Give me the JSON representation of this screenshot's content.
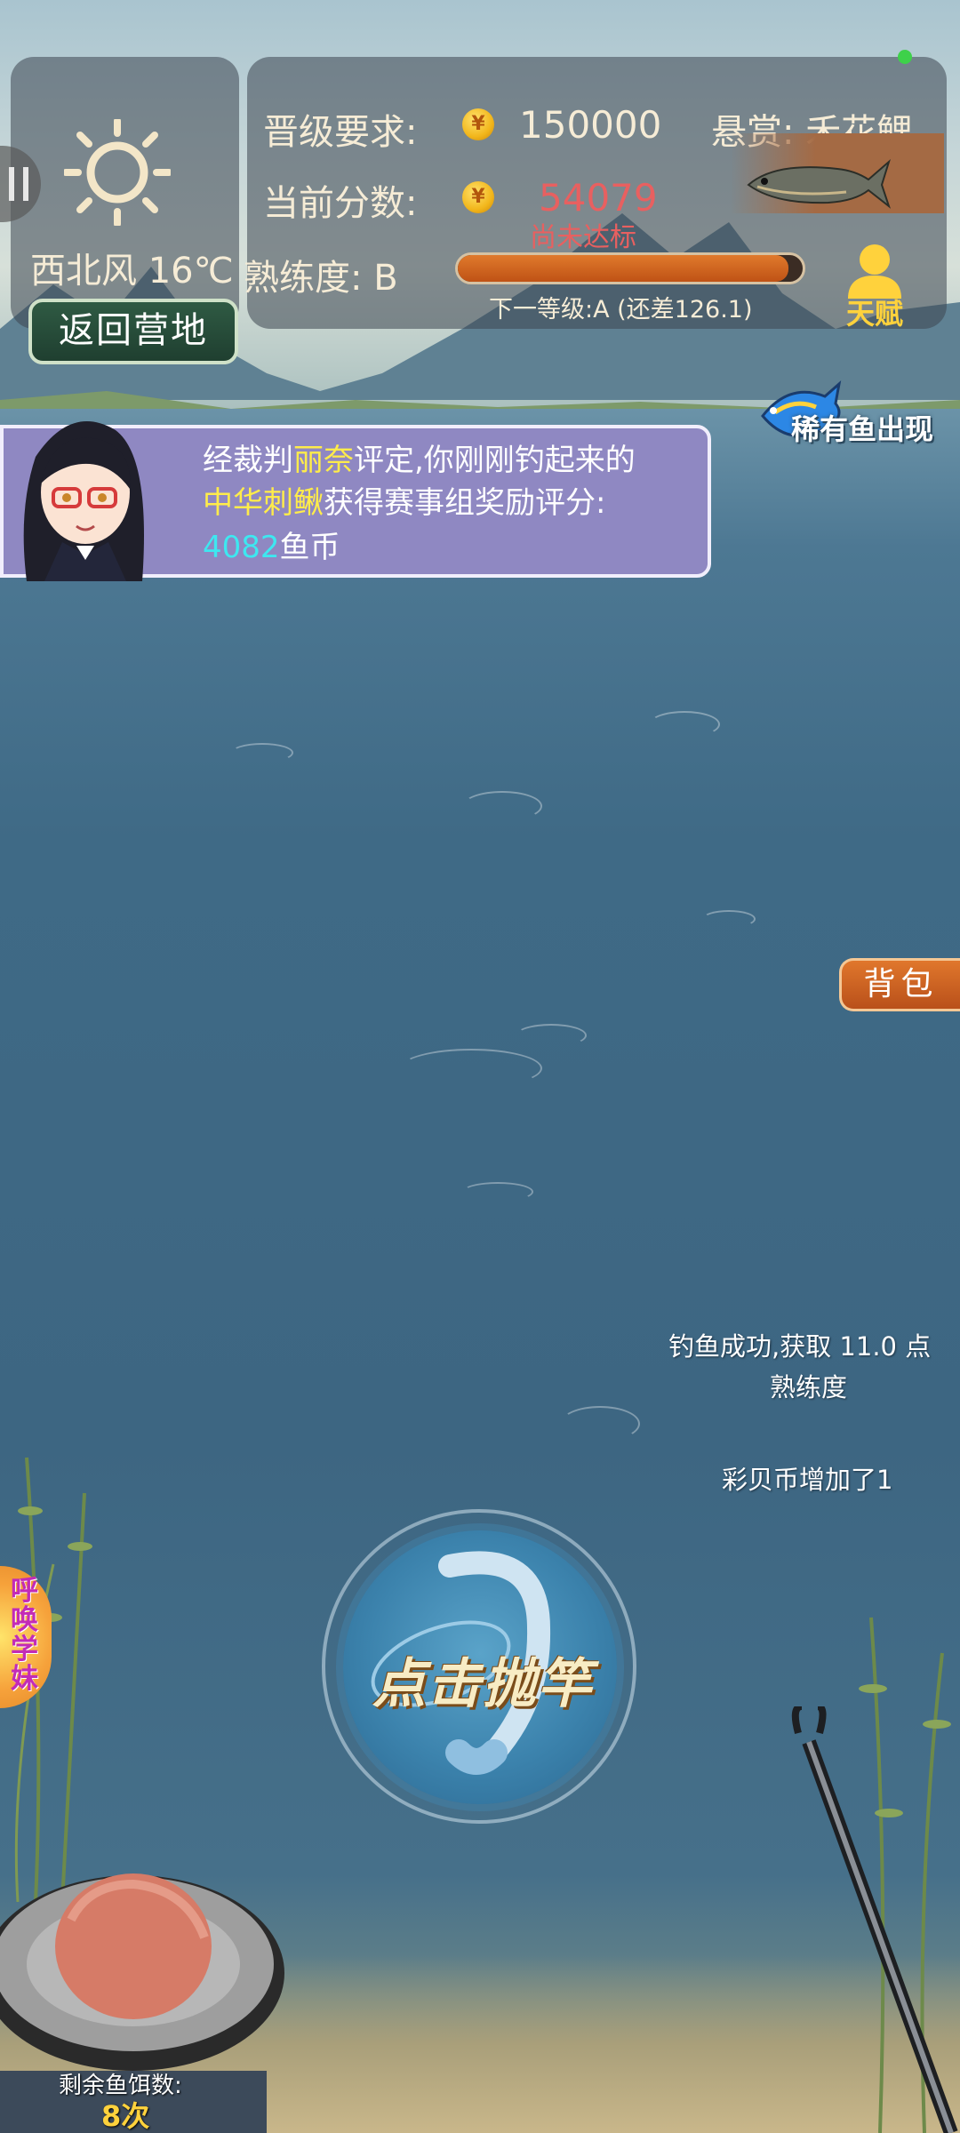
{
  "weather": {
    "wind": "西北风",
    "temperature": "16℃",
    "icon": "sun-icon"
  },
  "buttons": {
    "return_camp": "返回营地",
    "bag": "背包",
    "cast": "点击抛竿",
    "summon": "呼唤学妹",
    "talent": "天赋"
  },
  "stats": {
    "promotion_label": "晋级要求:",
    "promotion_value": "150000",
    "score_label": "当前分数:",
    "score_value": "54079",
    "score_status": "尚未达标",
    "proficiency_label": "熟练度:",
    "proficiency_grade": "B",
    "progress_percent": 96,
    "next_level": "下一等级:A (还差126.1)"
  },
  "bounty": {
    "label": "悬赏:",
    "fish": "禾花鲤"
  },
  "rare_notice": "稀有鱼出现",
  "judge_message": {
    "line1_part1": "经裁判",
    "line1_name": "丽奈",
    "line1_part2": "评定,你刚刚钓起来的",
    "line2_fish": "中华刺鳅",
    "line2_part2": "获得赛事组奖励评分:",
    "line3_amount": "4082",
    "line3_unit": "鱼币"
  },
  "logs": {
    "catch_line1": "钓鱼成功,获取 11.0 点",
    "catch_line2": "熟练度",
    "shell_coin": "彩贝币增加了1"
  },
  "bait": {
    "label": "剩余鱼饵数:",
    "count": "8次"
  },
  "colors": {
    "accent_orange": "#bf5215",
    "highlight_yellow": "#ffec4a",
    "highlight_cyan": "#3ee7f0",
    "score_red": "#e86060"
  }
}
